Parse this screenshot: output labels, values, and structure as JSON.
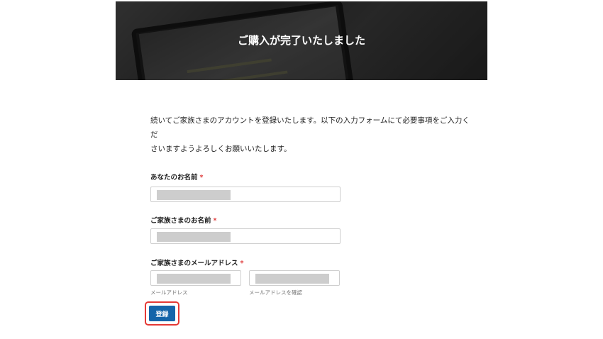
{
  "hero": {
    "title": "ご購入が完了いたしました"
  },
  "intro": {
    "line1": "続いてご家族さまのアカウントを登録いたします。以下の入力フォームにて必要事項をご入力くだ",
    "line2": "さいますようよろしくお願いいたします。"
  },
  "form": {
    "required_mark": "*",
    "your_name": {
      "label": "あなたのお名前",
      "value": ""
    },
    "family_name": {
      "label": "ご家族さまのお名前",
      "value": ""
    },
    "family_email": {
      "label": "ご家族さまのメールアドレス",
      "email_hint": "メールアドレス",
      "confirm_hint": "メールアドレスを確認",
      "email_value": "",
      "confirm_value": ""
    },
    "submit_label": "登録"
  },
  "colors": {
    "accent": "#1565a9",
    "highlight": "#e53935",
    "required": "#e04040"
  }
}
